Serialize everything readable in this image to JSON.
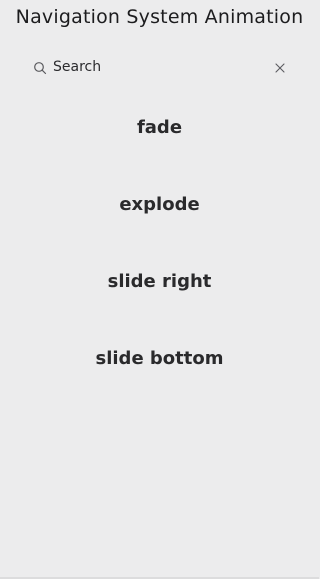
{
  "header": {
    "title": "Navigation System Animation"
  },
  "search": {
    "placeholder": "Search",
    "value": "",
    "icon": "search-icon",
    "clear_icon": "close-icon"
  },
  "menu": {
    "items": [
      {
        "label": "fade"
      },
      {
        "label": "explode"
      },
      {
        "label": "slide right"
      },
      {
        "label": "slide bottom"
      }
    ]
  },
  "colors": {
    "background": "#ececed",
    "text": "#1c1c1e",
    "icon": "#5a5a5e"
  }
}
